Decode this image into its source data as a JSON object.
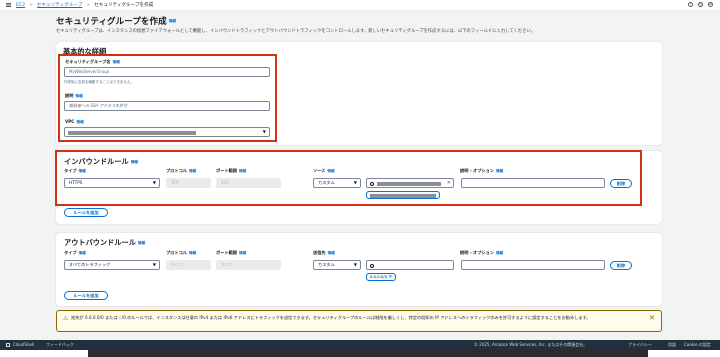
{
  "breadcrumb": {
    "ec2": "EC2",
    "sg": "セキュリティグループ",
    "current": "セキュリティグループを作成"
  },
  "title": "セキュリティグループを作成",
  "info": "情報",
  "description": "セキュリティグループは、インスタンスの仮想ファイアウォールとして機能し、インバウンドトラフィックとアウトバウンドトラフィックをコントロールします。新しいセキュリティグループを作成するには、以下のフィールドに入力してください。",
  "basic": {
    "heading": "基本的な詳細",
    "name_label": "セキュリティグループ名",
    "name_placeholder": "MyWebServerGroup",
    "name_hint": "作成後に名前を編集することはできません。",
    "desc_label": "説明",
    "desc_placeholder": "開発者への SSH アクセスを許可",
    "vpc_label": "VPC"
  },
  "inbound": {
    "heading": "インバウンドルール",
    "col_type": "タイプ",
    "col_protocol": "プロトコル",
    "col_port": "ポート範囲",
    "col_source": "ソース",
    "col_desc": "説明 - オプション",
    "type_value": "HTTPS",
    "protocol_value": "TCP",
    "port_value": "443",
    "source_value": "カスタム",
    "delete": "削除",
    "add_rule": "ルールを追加"
  },
  "outbound": {
    "heading": "アウトバウンドルール",
    "col_type": "タイプ",
    "col_protocol": "プロトコル",
    "col_port": "ポート範囲",
    "col_dest": "送信先",
    "col_desc": "説明 - オプション",
    "type_value": "すべてのトラフィック",
    "protocol_value": "すべて",
    "port_value": "すべて",
    "dest_value": "カスタム",
    "token": "0.0.0.0/0",
    "delete": "削除",
    "add_rule": "ルールを追加"
  },
  "warning": "宛先が 0.0.0.0/0 または ::/0 のルールでは、インスタンスは任意の IPv4 または IPv6 アドレスにトラフィックを送信できます。セキュリティグループのルールは制限を厳しくし、特定の既知の IP アドレスへのトラフィックのみを許可するように設定することをお勧めします。",
  "footer": {
    "cloudshell": "CloudShell",
    "feedback": "フィードバック",
    "copyright": "© 2025, Amazon Web Services, Inc. またはその関連会社。",
    "privacy": "プライバシー",
    "terms": "用語",
    "cookie": "Cookie の設定"
  }
}
